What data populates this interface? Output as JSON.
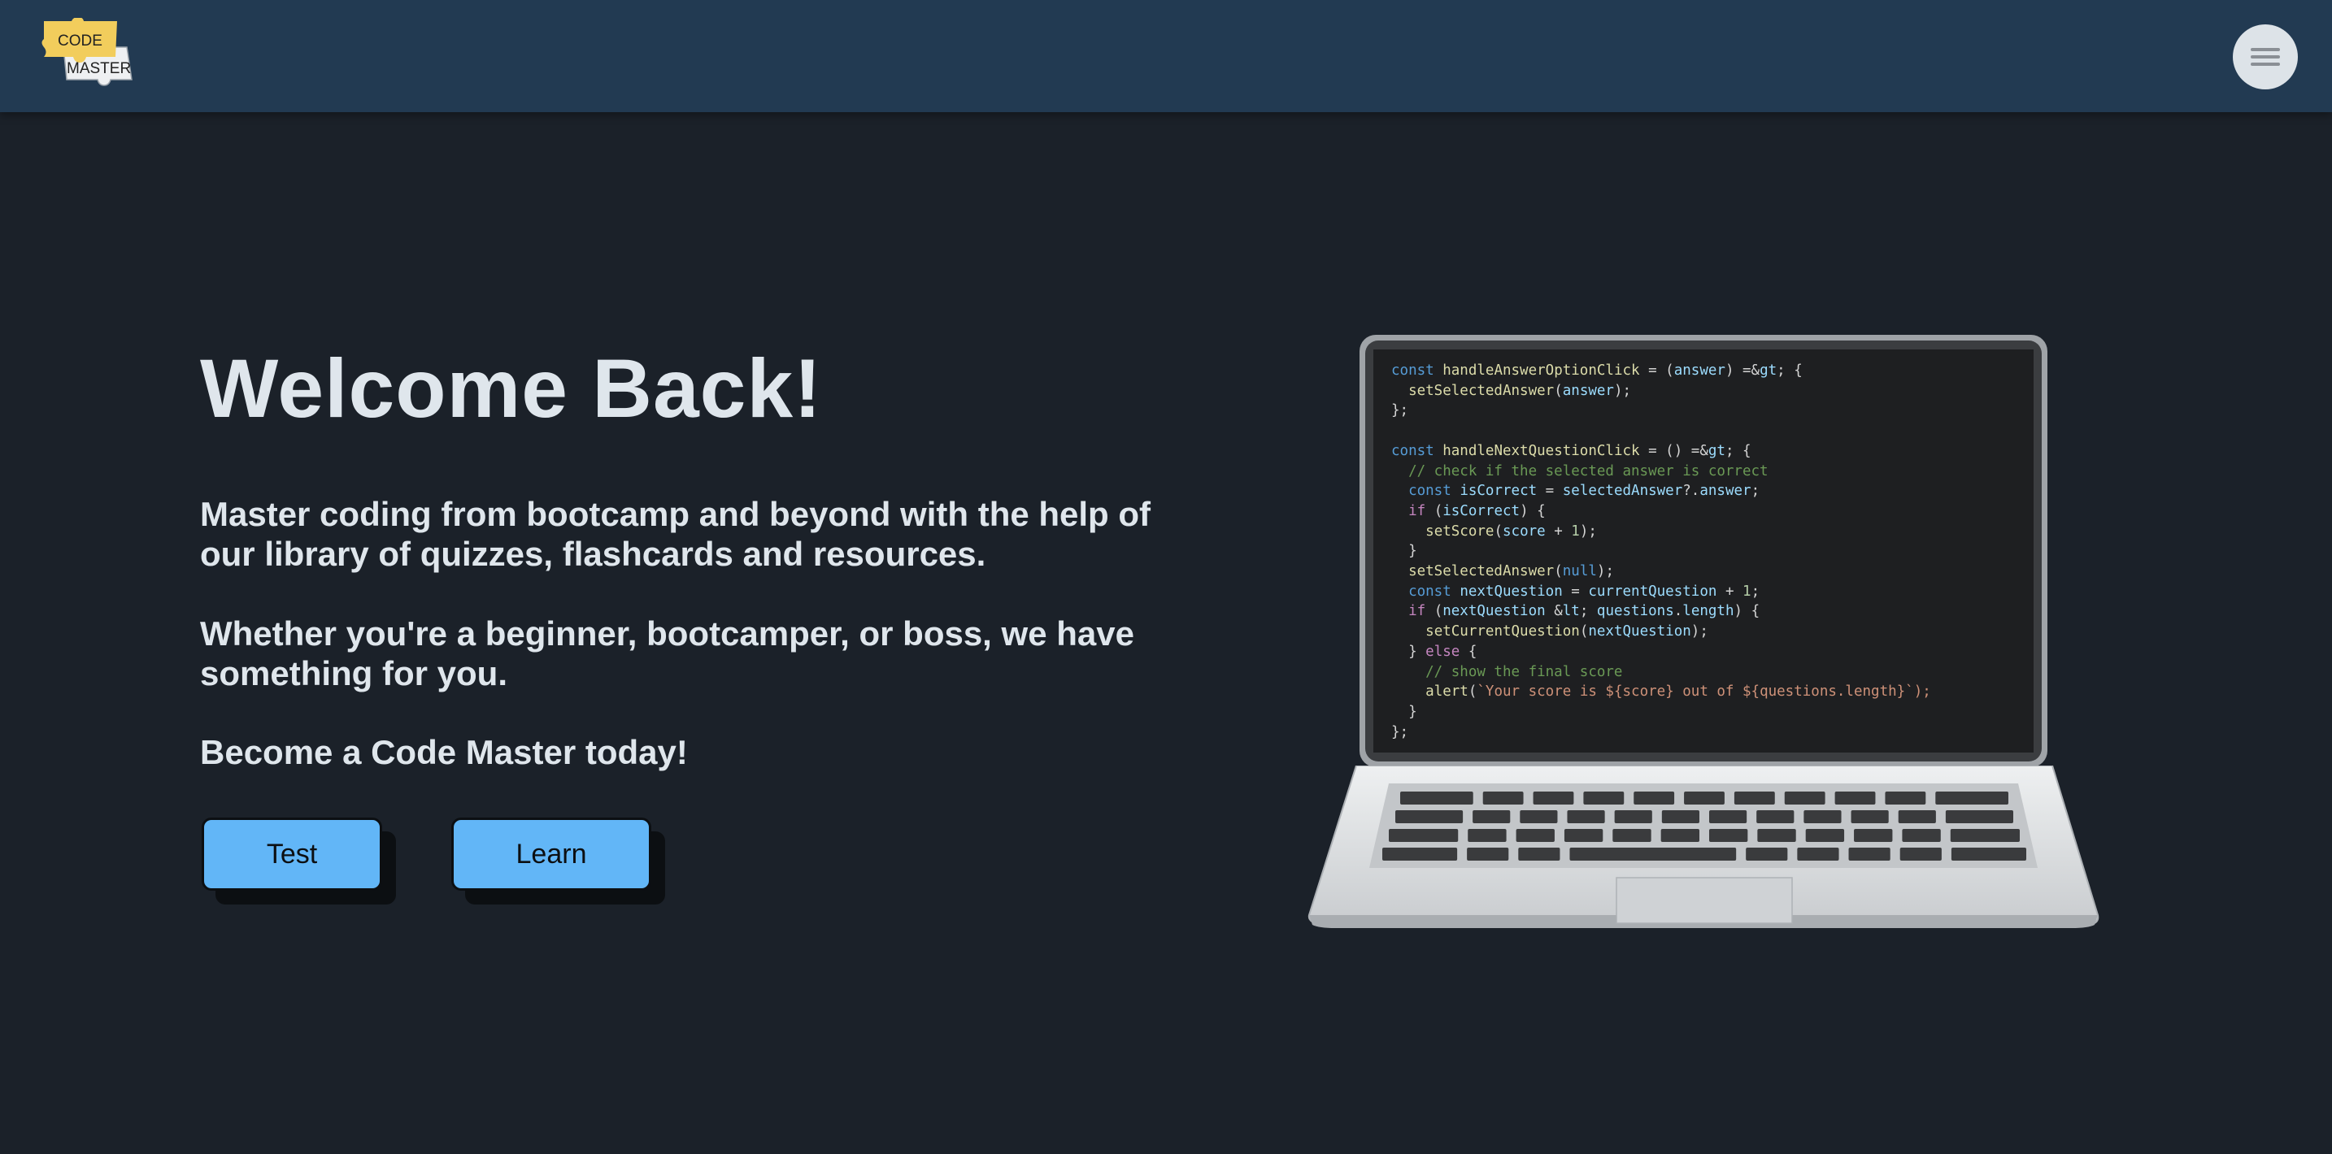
{
  "header": {
    "logo": {
      "line1": "CODE",
      "line2": "MASTER"
    },
    "menu_icon": "hamburger-icon"
  },
  "hero": {
    "title": "Welcome Back!",
    "paragraph1": "Master coding from bootcamp and beyond with the help of our library of quizzes, flashcards and resources.",
    "paragraph2": "Whether you're a beginner, bootcamper, or boss, we have something for you.",
    "paragraph3": "Become a Code Master today!",
    "buttons": {
      "test": "Test",
      "learn": "Learn"
    }
  },
  "laptop": {
    "code_lines": [
      "const handleAnswerOptionClick = (answer) => {",
      "  setSelectedAnswer(answer);",
      "};",
      "",
      "const handleNextQuestionClick = () => {",
      "  // check if the selected answer is correct",
      "  const isCorrect = selectedAnswer?.answer;",
      "  if (isCorrect) {",
      "    setScore(score + 1);",
      "  }",
      "  setSelectedAnswer(null);",
      "  const nextQuestion = currentQuestion + 1;",
      "  if (nextQuestion < questions.length) {",
      "    setCurrentQuestion(nextQuestion);",
      "  } else {",
      "    // show the final score",
      "    alert(`Your score is ${score} out of ${questions.length}`);",
      "  }",
      "};"
    ]
  },
  "colors": {
    "header_bg": "#223a52",
    "page_bg": "#1b2129",
    "text": "#dfe6ec",
    "button_bg": "#62b6f7",
    "logo_yellow": "#f2cd5c"
  }
}
